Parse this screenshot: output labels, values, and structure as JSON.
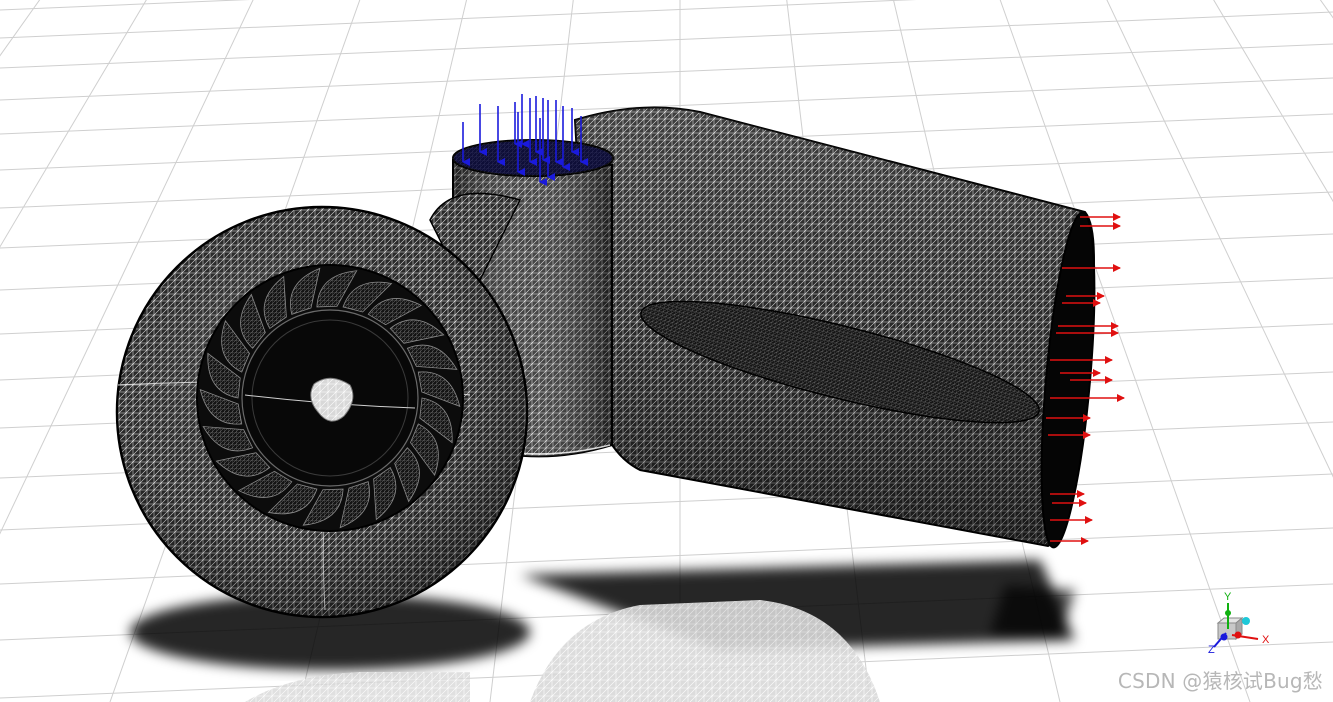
{
  "viewport": {
    "background": "#ffffff",
    "grid_color": "#cfcfcf",
    "mesh_color": "#000000",
    "mesh_highlight": "#bdbdbd",
    "inlet_arrow_color": "#1a1adc",
    "outlet_arrow_color": "#e01010"
  },
  "model": {
    "parts": [
      "volute",
      "runner",
      "inlet-pipe",
      "draft-tube"
    ],
    "inlet_boundary": "velocity-inlet-arrows",
    "outlet_boundary": "pressure-outlet-arrows"
  },
  "triad": {
    "x_label": "X",
    "y_label": "Y",
    "z_label": "Z",
    "x_color": "#e01010",
    "y_color": "#10b010",
    "z_color": "#1a1adc"
  },
  "watermark": {
    "text": "CSDN @猿核试Bug愁"
  }
}
